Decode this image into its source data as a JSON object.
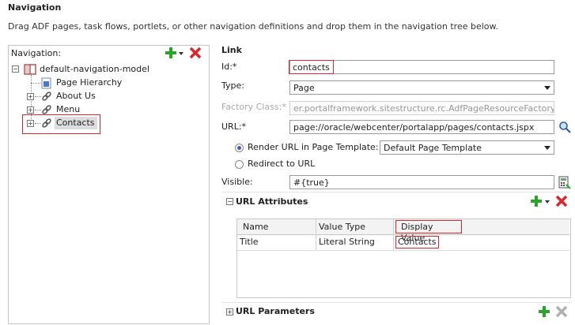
{
  "header": {
    "title": "Navigation",
    "description": "Drag ADF pages, task flows, portlets, or other navigation definitions and drop them in the navigation tree below."
  },
  "tree": {
    "label": "Navigation:",
    "root": "default-navigation-model",
    "items": [
      {
        "label": "Page Hierarchy"
      },
      {
        "label": "About Us"
      },
      {
        "label": "Menu"
      },
      {
        "label": "Contacts"
      }
    ]
  },
  "link": {
    "section_title": "Link",
    "id_label": "Id:*",
    "id_value": "contacts",
    "type_label": "Type:",
    "type_value": "Page",
    "factory_label": "Factory Class:*",
    "factory_value": "er.portalframework.sitestructure.rc.AdfPageResourceFactory",
    "url_label": "URL:*",
    "url_value": "page://oracle/webcenter/portalapp/pages/contacts.jspx",
    "render_option": "Render URL in Page Template:",
    "template_value": "Default Page Template",
    "redirect_option": "Redirect to URL",
    "visible_label": "Visible:",
    "visible_value": "#{true}"
  },
  "url_attributes": {
    "title": "URL Attributes",
    "columns": [
      "Name",
      "Value Type",
      "Display Value"
    ],
    "rows": [
      {
        "name": "Title",
        "value_type": "Literal String",
        "display_value": "Contacts"
      }
    ]
  },
  "url_parameters": {
    "title": "URL Parameters"
  },
  "colors": {
    "highlight_red": "#d9262d",
    "add_green": "#2aa52a",
    "selected_bg": "#dcdcdc"
  }
}
